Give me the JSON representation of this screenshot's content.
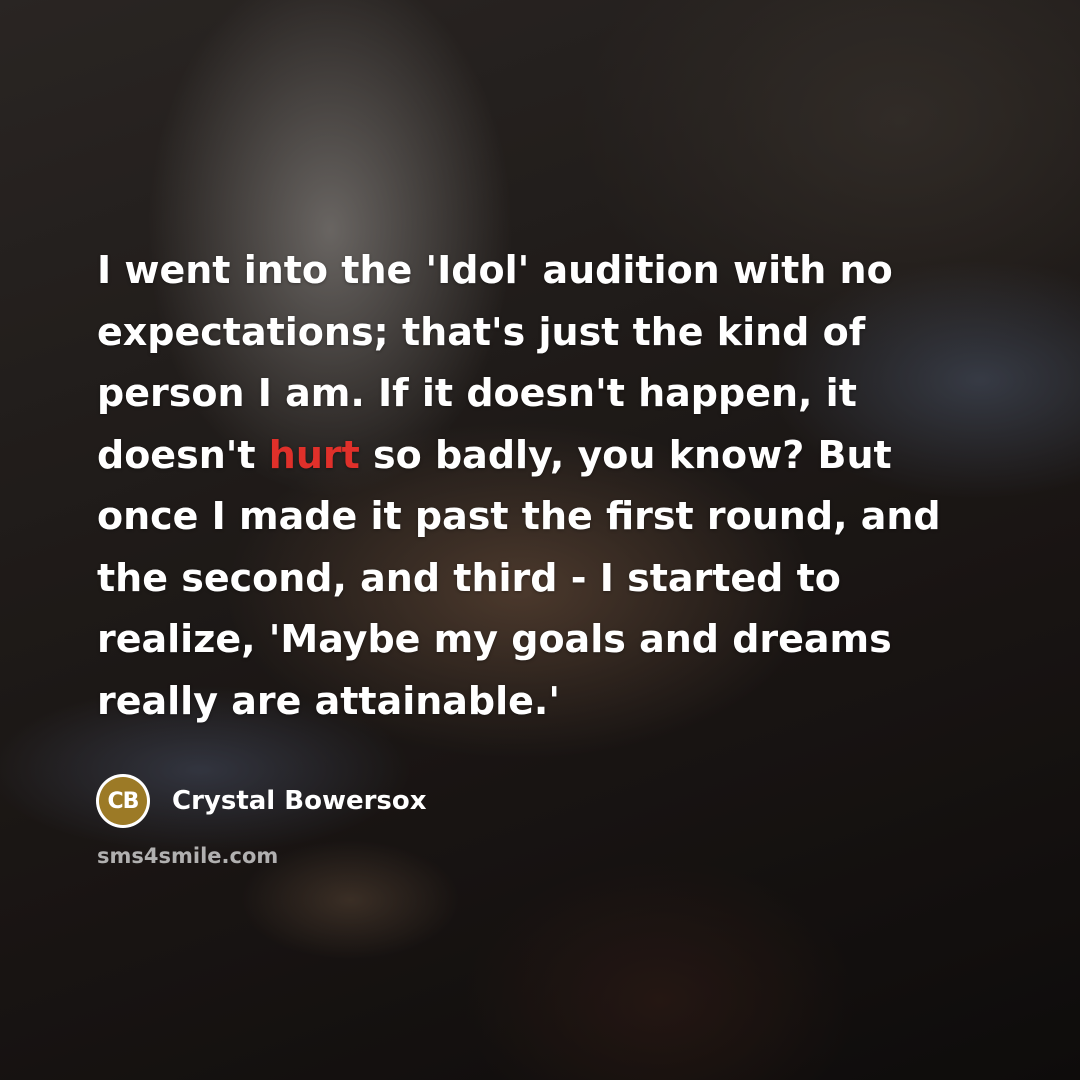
{
  "quote": {
    "part1": "I went into the 'Idol' audition with no expectations; that's just the kind of person I am. If it doesn't happen, it doesn't ",
    "highlight": "hurt",
    "part2": " so badly, you know? But once I made it past the first round, and the second, and third - I started to realize, 'Maybe my goals and dreams really are attainable.'"
  },
  "author": {
    "initials": "CB",
    "name": "Crystal Bowersox"
  },
  "site": "sms4smile.com",
  "colors": {
    "text": "#ffffff",
    "highlight": "#e0302a",
    "badge": "#9c7a26"
  }
}
